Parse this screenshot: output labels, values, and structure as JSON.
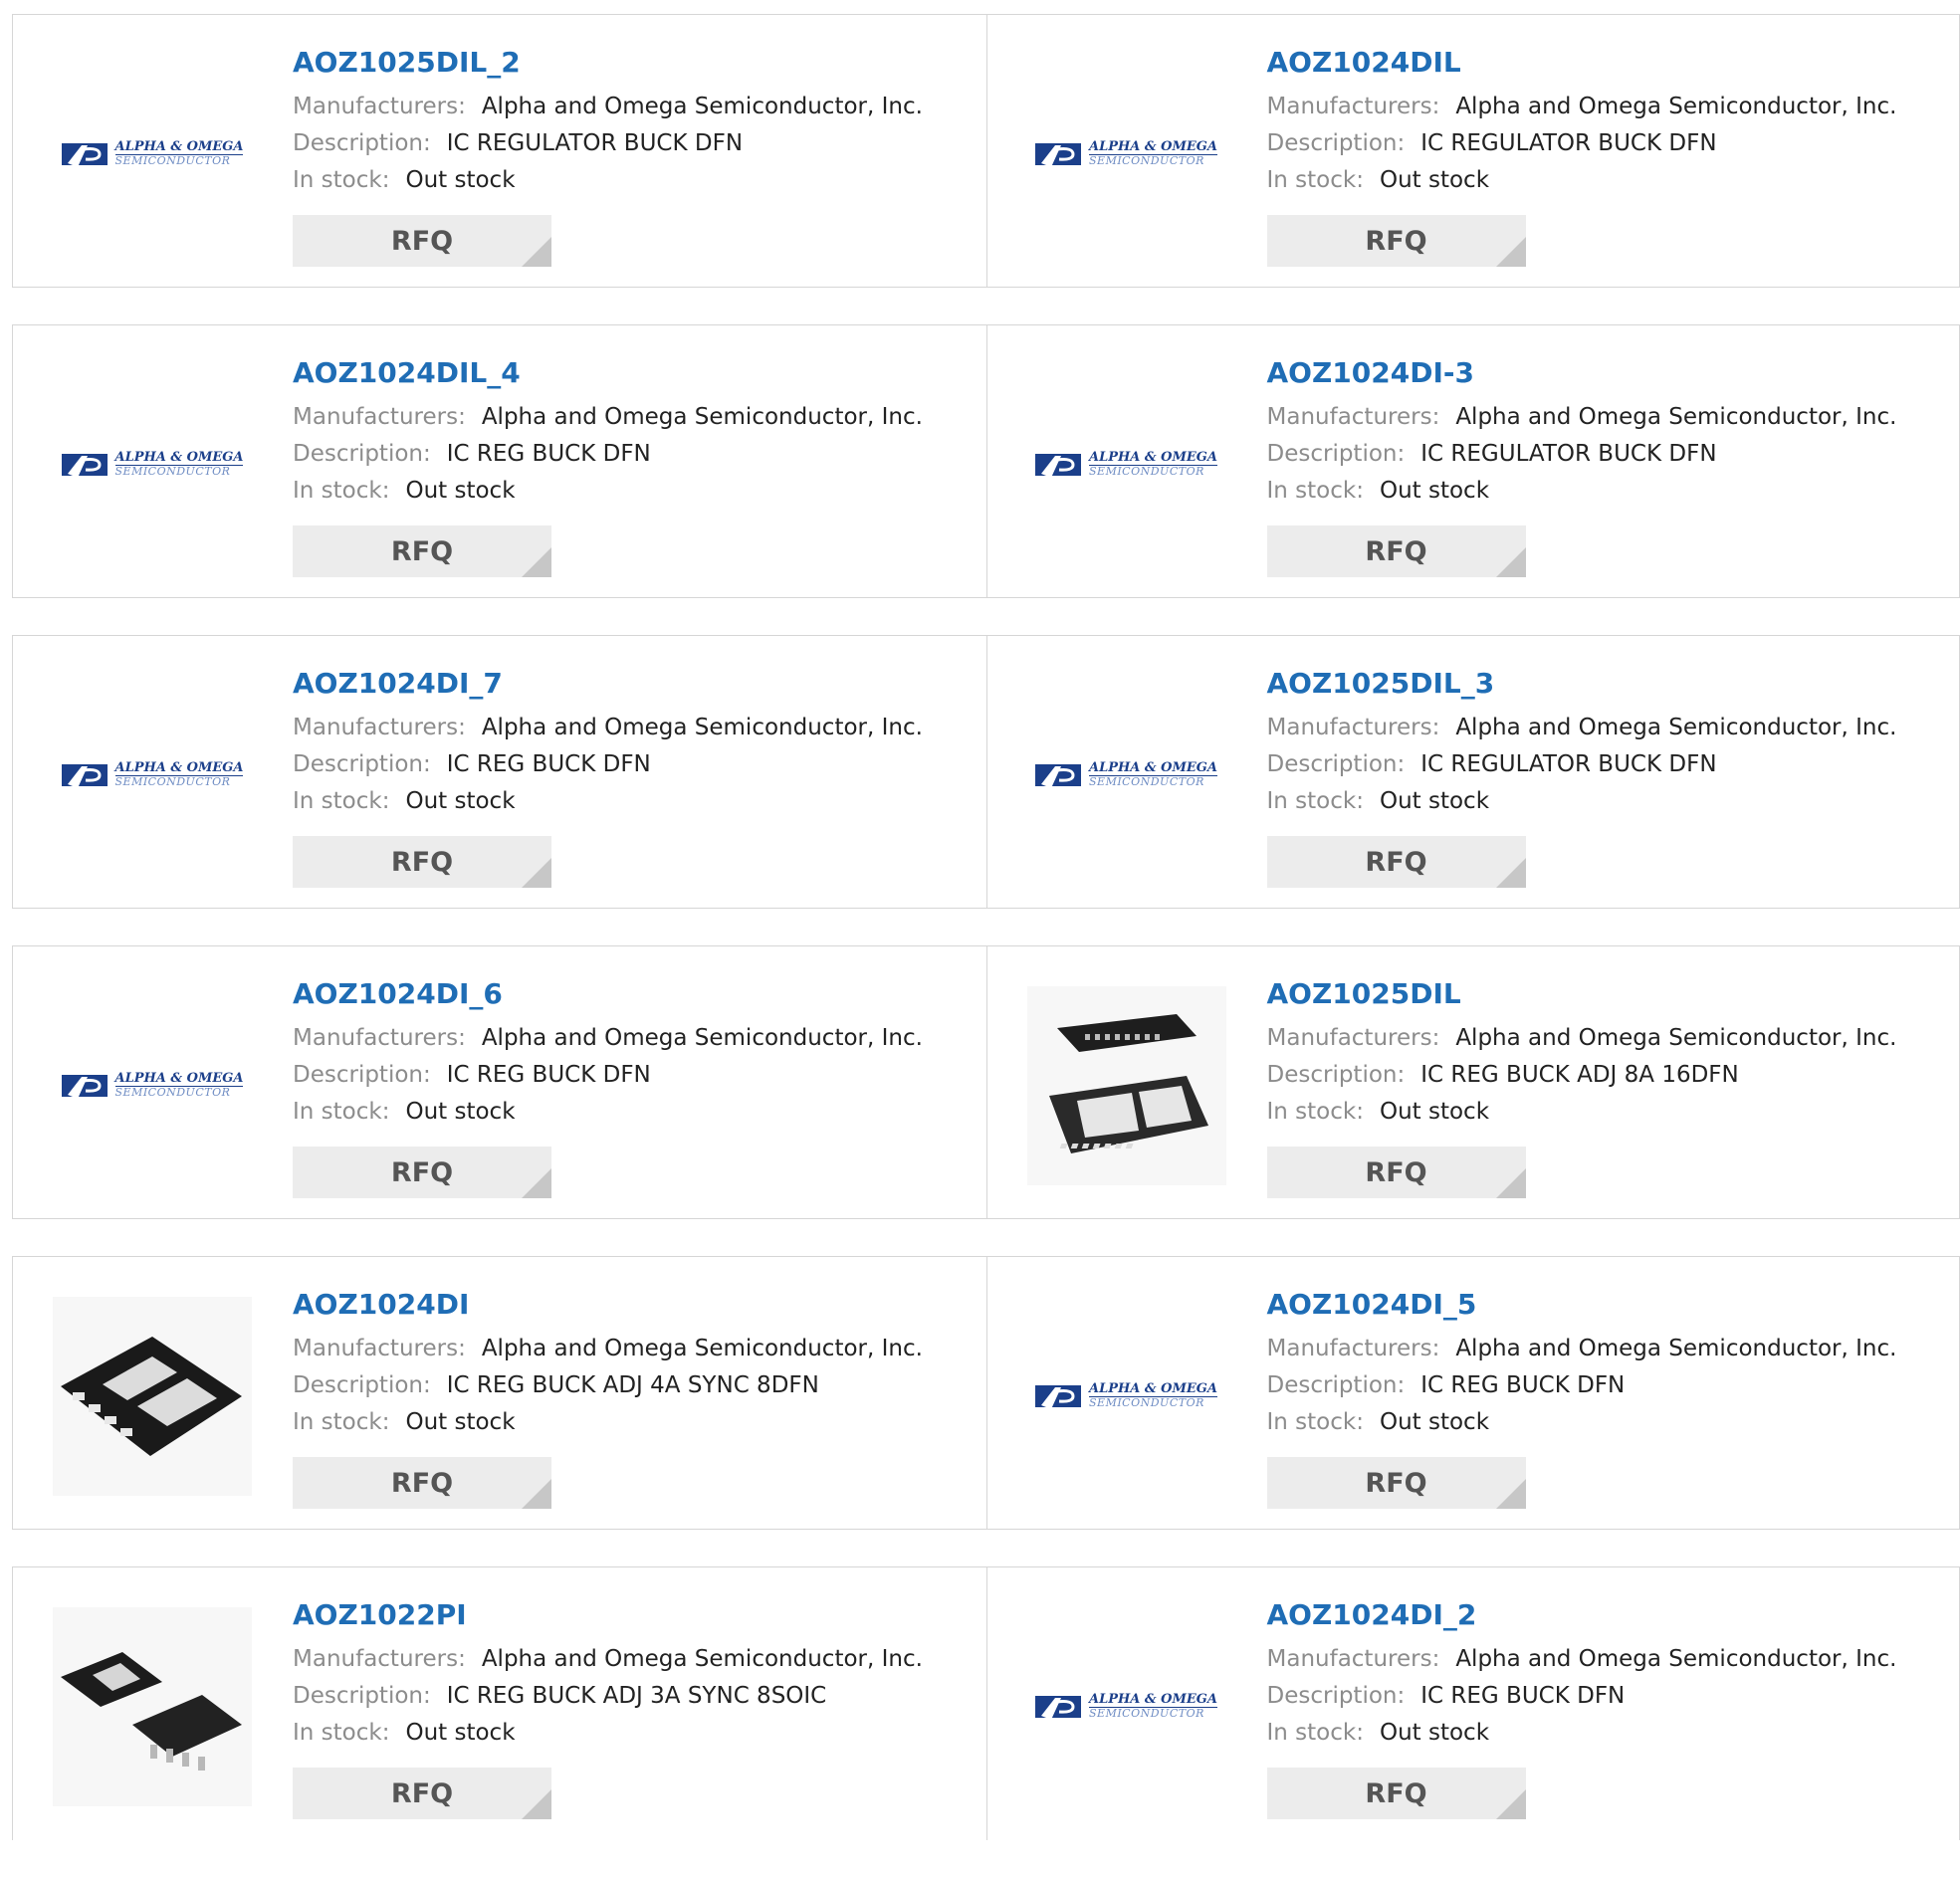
{
  "labels": {
    "manufacturers": "Manufacturers:",
    "description": "Description:",
    "in_stock": "In stock:",
    "rfq": "RFQ"
  },
  "brand_logo": {
    "line1": "ALPHA & OMEGA",
    "line2": "SEMICONDUCTOR",
    "color": "#1b3f8a"
  },
  "colors": {
    "part_link": "#1f6db5",
    "border": "#d6d6d6",
    "rfq_bg": "#ececec"
  },
  "products": [
    {
      "part": "AOZ1025DIL_2",
      "manufacturer": "Alpha and Omega Semiconductor, Inc.",
      "description": "IC REGULATOR BUCK DFN",
      "stock": "Out stock",
      "image": "alpha-omega-logo"
    },
    {
      "part": "AOZ1024DIL",
      "manufacturer": "Alpha and Omega Semiconductor, Inc.",
      "description": "IC REGULATOR BUCK DFN",
      "stock": "Out stock",
      "image": "alpha-omega-logo"
    },
    {
      "part": "AOZ1024DIL_4",
      "manufacturer": "Alpha and Omega Semiconductor, Inc.",
      "description": "IC REG BUCK DFN",
      "stock": "Out stock",
      "image": "alpha-omega-logo"
    },
    {
      "part": "AOZ1024DI-3",
      "manufacturer": "Alpha and Omega Semiconductor, Inc.",
      "description": "IC REGULATOR BUCK DFN",
      "stock": "Out stock",
      "image": "alpha-omega-logo"
    },
    {
      "part": "AOZ1024DI_7",
      "manufacturer": "Alpha and Omega Semiconductor, Inc.",
      "description": "IC REG BUCK DFN",
      "stock": "Out stock",
      "image": "alpha-omega-logo"
    },
    {
      "part": "AOZ1025DIL_3",
      "manufacturer": "Alpha and Omega Semiconductor, Inc.",
      "description": "IC REGULATOR BUCK DFN",
      "stock": "Out stock",
      "image": "alpha-omega-logo"
    },
    {
      "part": "AOZ1024DI_6",
      "manufacturer": "Alpha and Omega Semiconductor, Inc.",
      "description": "IC REG BUCK DFN",
      "stock": "Out stock",
      "image": "alpha-omega-logo"
    },
    {
      "part": "AOZ1025DIL",
      "manufacturer": "Alpha and Omega Semiconductor, Inc.",
      "description": "IC REG BUCK ADJ 8A 16DFN",
      "stock": "Out stock",
      "image": "dfn16-chip-photo"
    },
    {
      "part": "AOZ1024DI",
      "manufacturer": "Alpha and Omega Semiconductor, Inc.",
      "description": "IC REG BUCK ADJ 4A SYNC 8DFN",
      "stock": "Out stock",
      "image": "dfn8-chip-photo"
    },
    {
      "part": "AOZ1024DI_5",
      "manufacturer": "Alpha and Omega Semiconductor, Inc.",
      "description": "IC REG BUCK DFN",
      "stock": "Out stock",
      "image": "alpha-omega-logo"
    },
    {
      "part": "AOZ1022PI",
      "manufacturer": "Alpha and Omega Semiconductor, Inc.",
      "description": "IC REG BUCK ADJ 3A SYNC 8SOIC",
      "stock": "Out stock",
      "image": "soic8-chip-photo"
    },
    {
      "part": "AOZ1024DI_2",
      "manufacturer": "Alpha and Omega Semiconductor, Inc.",
      "description": "IC REG BUCK DFN",
      "stock": "Out stock",
      "image": "alpha-omega-logo"
    }
  ]
}
